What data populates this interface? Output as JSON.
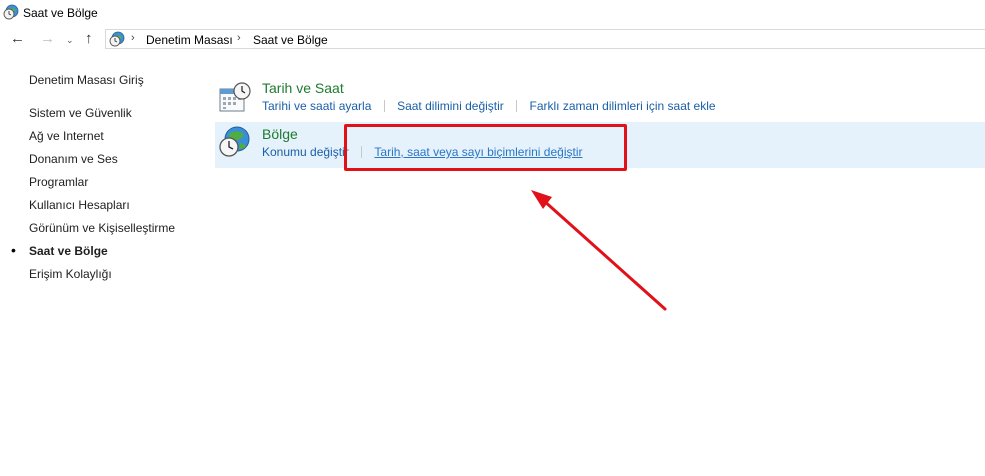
{
  "window": {
    "title": "Saat ve Bölge"
  },
  "addressbar": {
    "crumbs": [
      "Denetim Masası",
      "Saat ve Bölge"
    ],
    "separator": "›"
  },
  "nav": {
    "back": "←",
    "forward": "→",
    "recent": "⌄",
    "up": "↑"
  },
  "sidebar": {
    "items": [
      {
        "label": "Denetim Masası Giriş"
      },
      {
        "label": "Sistem ve Güvenlik"
      },
      {
        "label": "Ağ ve Internet"
      },
      {
        "label": "Donanım ve Ses"
      },
      {
        "label": "Programlar"
      },
      {
        "label": "Kullanıcı Hesapları"
      },
      {
        "label": "Görünüm ve Kişiselleştirme"
      },
      {
        "label": "Saat ve Bölge",
        "active": true
      },
      {
        "label": "Erişim Kolaylığı"
      }
    ],
    "bullet": "•"
  },
  "categories": [
    {
      "title": "Tarih ve Saat",
      "icon": "calendar-clock-icon",
      "links": [
        "Tarihi ve saati ayarla",
        "Saat dilimini değiştir",
        "Farklı zaman dilimleri için saat ekle"
      ]
    },
    {
      "title": "Bölge",
      "icon": "globe-clock-icon",
      "links": [
        "Konumu değiştir",
        "Tarih, saat veya sayı biçimlerini değiştir"
      ]
    }
  ],
  "colors": {
    "category_title": "#1e7b2f",
    "link": "#1a5fa8",
    "hover_row": "#e5f1fb",
    "annotation": "#e1111a"
  }
}
